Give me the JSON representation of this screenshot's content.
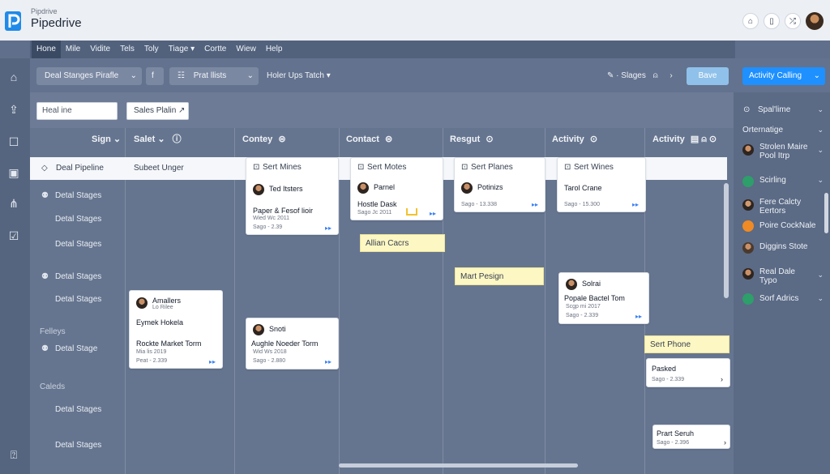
{
  "app": {
    "subtitle": "Pipdrive",
    "title": "Pipedrive"
  },
  "titlebar_icons": [
    "home-icon",
    "tablet-icon",
    "shuffle-icon"
  ],
  "menu": [
    "Hone",
    "Mile",
    "Vidite",
    "Tels",
    "Toly",
    "Tiage ▾",
    "Cortte",
    "Wiew",
    "Help"
  ],
  "toolbar": {
    "pipeline_select": "Deal Stanges Pirafle",
    "filter_label": "Prat llists",
    "holder_label": "Holer Ups Tatch",
    "stages_label": "Slages",
    "save_label": "Bave"
  },
  "right_toolbar": {
    "activity_label": "Activity Calling"
  },
  "filter": {
    "input_value": "Heal ine",
    "sales_button": "Sales Plalin ↗"
  },
  "columns": [
    "Sign",
    "Salet",
    "Contey",
    "Contact",
    "Resgut",
    "Activity",
    "Activity"
  ],
  "whitebar": {
    "items": [
      "Deal Pipeline",
      "Subeet Unger",
      "Sert Mines",
      "Sert Motes",
      "Sert Planes",
      "Sert Wines"
    ]
  },
  "sidebar": {
    "labels": [
      "Detal Stages",
      "Detal Stages",
      "Detal Stages",
      "Detal Stages",
      "Detal Stages",
      "Detal Stage",
      "Detal Stages",
      "Detal Stages"
    ],
    "groups": [
      "Felleys",
      "Caleds"
    ]
  },
  "cards": [
    {
      "name": "Ted Itsters",
      "title": "Paper & Fesof lioir",
      "meta": "Wied Wc 2011",
      "meta2": "Sago - 2.39"
    },
    {
      "name": "Parnel",
      "title": "Hostle Dask",
      "meta": "Sago Jc 2011"
    },
    {
      "name": "Potinizs",
      "meta": "Sago - 13.338"
    },
    {
      "name": "Tarol Crane",
      "meta": "Sago - 15.300"
    },
    {
      "name": "Amallers",
      "sub": "Lo Rilee",
      "title": "Eymek Hokela",
      "title2": "Rockte Market Torm",
      "meta": "Mia lis 2019",
      "meta2": "Peat - 2.339"
    },
    {
      "name": "Snoti",
      "title": "Aughle Noeder Torm",
      "meta": "Wid Ws 2018",
      "meta2": "Sago - 2.880"
    },
    {
      "name": "Solrai",
      "title": "Popale Bactel Tom",
      "meta": "Scgp mi 2017",
      "meta2": "Sago - 2.339"
    },
    {
      "name": "Pasked",
      "meta": "Sago - 2.339"
    },
    {
      "name": "Prart Seruh",
      "meta": "Sago - 2.396"
    }
  ],
  "stickies": [
    "Allian Cacrs",
    "Mart Pesign",
    "Sert Phone"
  ],
  "right_panel": [
    "Spal'lime",
    "Orternatige",
    "Strolen Maire",
    "Pool Itrp",
    "Scirling",
    "Fere Calcty",
    "Eertors",
    "Poire CockNale",
    "Diggins Stote",
    "Real Dale",
    "Typo",
    "Sorf Adrics"
  ],
  "colors": {
    "accent": "#1e90ff",
    "save": "#8fc1ea",
    "sticky": "#fdf7c3"
  }
}
